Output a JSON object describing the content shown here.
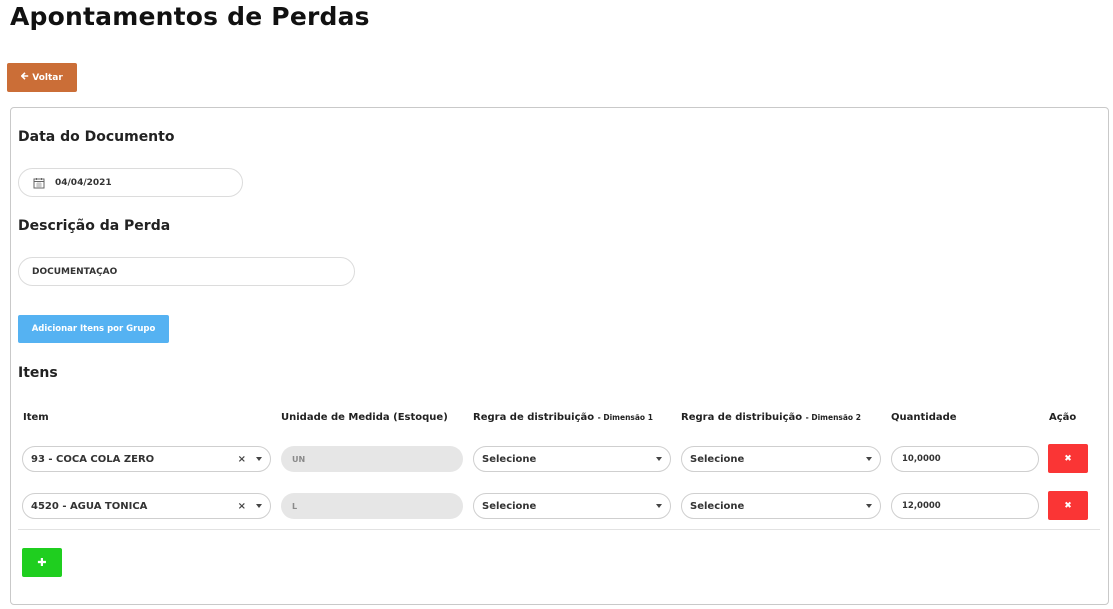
{
  "page": {
    "title": "Apontamentos de Perdas"
  },
  "back_button": {
    "icon": "arrow-left-icon",
    "label": "Voltar",
    "arrow": "🡐"
  },
  "document_date": {
    "section_title": "Data do Documento",
    "icon": "calendar-icon",
    "value": "04/04/2021"
  },
  "description": {
    "section_title": "Descrição da Perda",
    "value": "DOCUMENTAÇÃO"
  },
  "add_group_button": {
    "label": "Adicionar Itens por Grupo"
  },
  "items": {
    "section_title": "Itens",
    "headers": {
      "item": "Item",
      "unit": "Unidade de Medida (Estoque)",
      "rule1": "Regra de distribuição",
      "rule1_small": "- Dimensão 1",
      "rule2": "Regra de distribuição",
      "rule2_small": "- Dimensão 2",
      "quantity": "Quantidade",
      "action": "Ação"
    },
    "rows": [
      {
        "item": "93 - COCA COLA ZERO",
        "unit": "UN",
        "rule1": "Selecione",
        "rule2": "Selecione",
        "quantity": "10,0000",
        "delete_icon": "✖"
      },
      {
        "item": "4520 - AGUA TONICA",
        "unit": "L",
        "rule1": "Selecione",
        "rule2": "Selecione",
        "quantity": "12,0000",
        "delete_icon": "✖"
      }
    ],
    "clear_icon": "×",
    "add_row_icon": "✚"
  },
  "colors": {
    "back_button": "#cb6e37",
    "add_group_button": "#55b2f2",
    "delete_button": "#fa3535",
    "add_row_button": "#1fce1f"
  }
}
